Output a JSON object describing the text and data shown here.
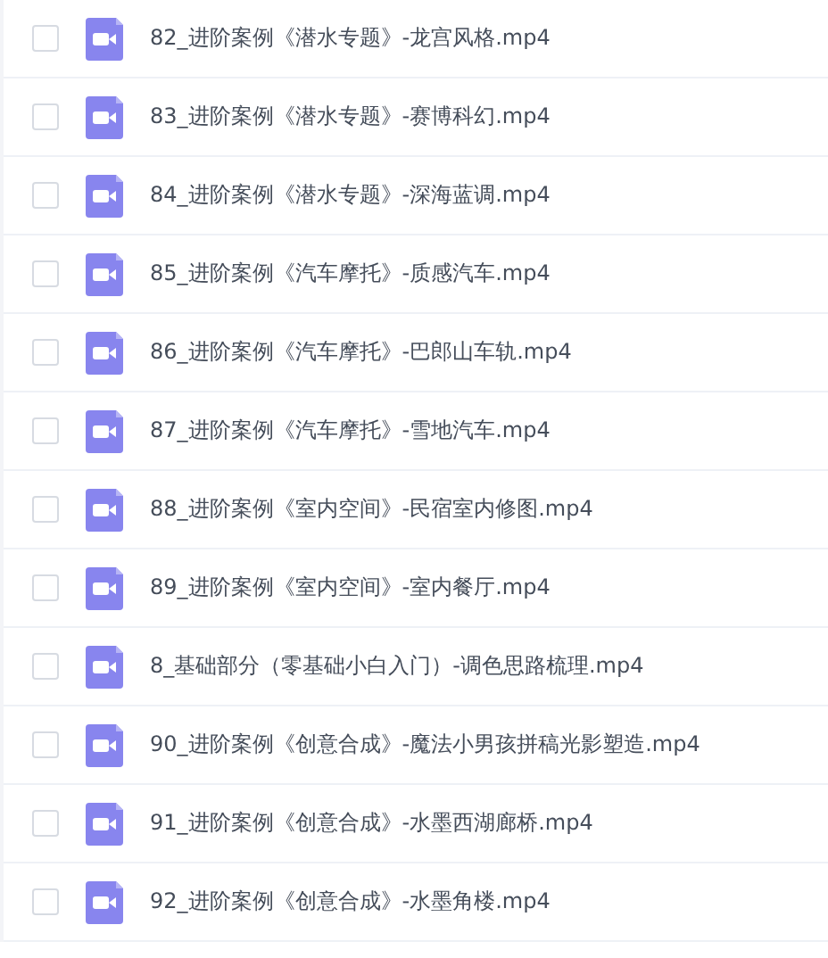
{
  "files": [
    {
      "name": "82_进阶案例《潜水专题》-龙宫风格.mp4",
      "checked": false
    },
    {
      "name": "83_进阶案例《潜水专题》-赛博科幻.mp4",
      "checked": false
    },
    {
      "name": "84_进阶案例《潜水专题》-深海蓝调.mp4",
      "checked": false
    },
    {
      "name": "85_进阶案例《汽车摩托》-质感汽车.mp4",
      "checked": false
    },
    {
      "name": "86_进阶案例《汽车摩托》-巴郎山车轨.mp4",
      "checked": false
    },
    {
      "name": "87_进阶案例《汽车摩托》-雪地汽车.mp4",
      "checked": false
    },
    {
      "name": "88_进阶案例《室内空间》-民宿室内修图.mp4",
      "checked": false
    },
    {
      "name": "89_进阶案例《室内空间》-室内餐厅.mp4",
      "checked": false
    },
    {
      "name": "8_基础部分（零基础小白入门）-调色思路梳理.mp4",
      "checked": false
    },
    {
      "name": "90_进阶案例《创意合成》-魔法小男孩拼稿光影塑造.mp4",
      "checked": false
    },
    {
      "name": "91_进阶案例《创意合成》-水墨西湖廊桥.mp4",
      "checked": false
    },
    {
      "name": "92_进阶案例《创意合成》-水墨角楼.mp4",
      "checked": false
    }
  ]
}
